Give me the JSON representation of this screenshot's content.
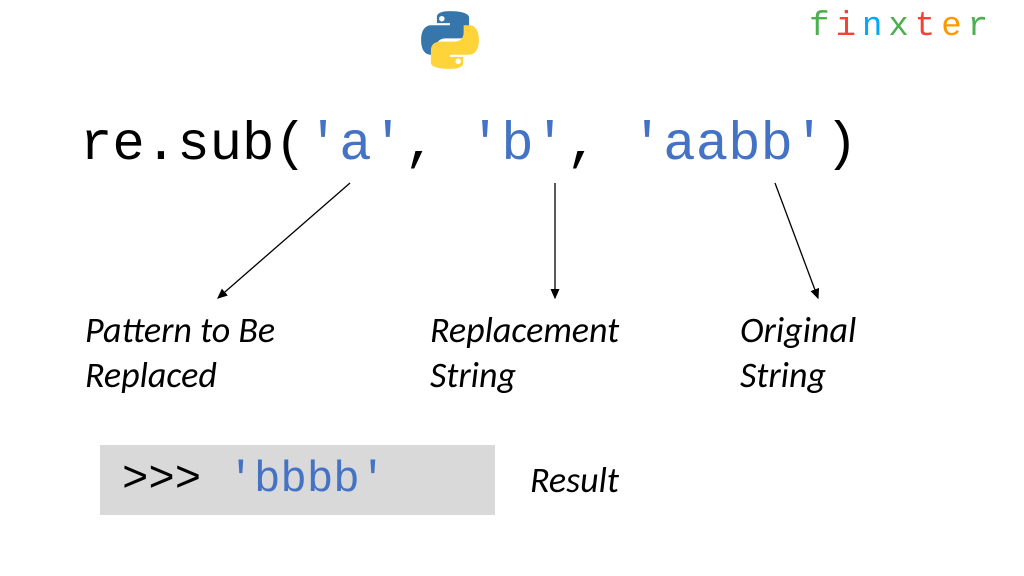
{
  "brand": {
    "letters": [
      {
        "char": "f",
        "color": "#4caf50"
      },
      {
        "char": "i",
        "color": "#f44336"
      },
      {
        "char": "n",
        "color": "#03a9f4"
      },
      {
        "char": "x",
        "color": "#4caf50"
      },
      {
        "char": "t",
        "color": "#f44336"
      },
      {
        "char": "e",
        "color": "#ff9800"
      },
      {
        "char": "r",
        "color": "#4caf50"
      }
    ]
  },
  "code": {
    "prefix": "re.sub(",
    "arg1": "'a'",
    "sep1": ", ",
    "arg2": "'b'",
    "sep2": ", ",
    "arg3": "'aabb'",
    "suffix": ")"
  },
  "labels": {
    "pattern_line1": "Pattern to Be",
    "pattern_line2": "Replaced",
    "replacement_line1": "Replacement",
    "replacement_line2": "String",
    "original_line1": "Original",
    "original_line2": "String",
    "result": "Result"
  },
  "result": {
    "prompt": ">>> ",
    "value": "'bbbb'"
  },
  "icons": {
    "python": "python-logo"
  }
}
